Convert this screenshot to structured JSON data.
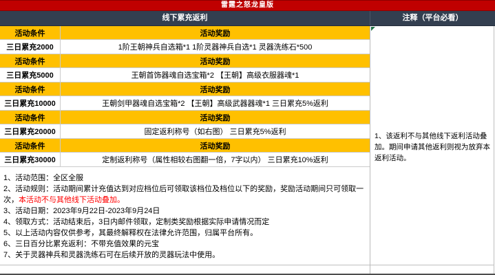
{
  "title": "雷霆之怒龙皇版",
  "sections": {
    "left_header": "线下累充返利",
    "right_header": "注释（平台必看）"
  },
  "table": {
    "condition_header": "活动条件",
    "reward_header": "活动奖励",
    "tiers": [
      {
        "condition": "三日累充2000",
        "reward": "1阶王朝神兵自选箱*1 1阶灵器神兵自选*1 灵器洗练石*500"
      },
      {
        "condition": "三日累充5000",
        "reward": "王朝首饰器魂自选宝箱*2 【王朝】高级衣服器魂*1"
      },
      {
        "condition": "三日累充10000",
        "reward": "王朝剑甲器魂自选宝箱*2 【王朝】高级武器器魂*1 三日累充5%返利"
      },
      {
        "condition": "三日累充20000",
        "reward": "固定返利称号（如右图） 三日累充5%返利"
      },
      {
        "condition": "三日累充30000",
        "reward": "定制返利称号（属性相较右图翻一倍，7字以内） 三日累充10%返利"
      }
    ]
  },
  "notes": {
    "n1": "1、活动范围：全区全服",
    "n2_prefix": "2、活动规则：活动期间累计充值达到对应档位后可领取该档位及档位以下的奖励，奖励活动期间只可领取一次，",
    "n2_highlight": "本活动不与其他线下活动叠加。",
    "n3": "3、活动日期：2023年9月22日-2023年9月24日",
    "n4": "4、领取方式：活动结束后，3日内邮件领取，定制类奖励根据实际申请情况而定",
    "n5": "5、以上活动内容仅供参考，其最终解释权在法律允许范围，归属平台所有。",
    "n6": "6、三日百分比累充返利：不带充值效果的元宝",
    "n7": "7、关于灵器神兵和灵器洗练石可在后续开放的灵器玩法中使用。"
  },
  "annotation": {
    "text": "1、该返利不与其他线下返利活动叠加。期间申请其他返利则视为放弃本返利活动。"
  },
  "colors": {
    "title_red": "#c00000",
    "header_navy": "#333f50",
    "row_gold": "#ffc000",
    "warning_red": "#ff0000",
    "marker_green": "#217346"
  }
}
